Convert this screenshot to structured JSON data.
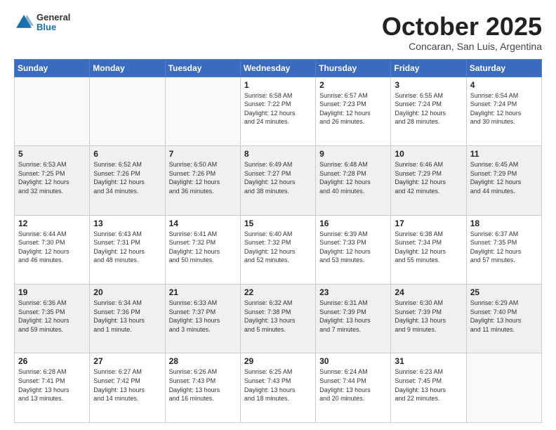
{
  "header": {
    "logo_general": "General",
    "logo_blue": "Blue",
    "month": "October 2025",
    "location": "Concaran, San Luis, Argentina"
  },
  "days_of_week": [
    "Sunday",
    "Monday",
    "Tuesday",
    "Wednesday",
    "Thursday",
    "Friday",
    "Saturday"
  ],
  "weeks": [
    [
      {
        "day": "",
        "info": ""
      },
      {
        "day": "",
        "info": ""
      },
      {
        "day": "",
        "info": ""
      },
      {
        "day": "1",
        "info": "Sunrise: 6:58 AM\nSunset: 7:22 PM\nDaylight: 12 hours\nand 24 minutes."
      },
      {
        "day": "2",
        "info": "Sunrise: 6:57 AM\nSunset: 7:23 PM\nDaylight: 12 hours\nand 26 minutes."
      },
      {
        "day": "3",
        "info": "Sunrise: 6:55 AM\nSunset: 7:24 PM\nDaylight: 12 hours\nand 28 minutes."
      },
      {
        "day": "4",
        "info": "Sunrise: 6:54 AM\nSunset: 7:24 PM\nDaylight: 12 hours\nand 30 minutes."
      }
    ],
    [
      {
        "day": "5",
        "info": "Sunrise: 6:53 AM\nSunset: 7:25 PM\nDaylight: 12 hours\nand 32 minutes."
      },
      {
        "day": "6",
        "info": "Sunrise: 6:52 AM\nSunset: 7:26 PM\nDaylight: 12 hours\nand 34 minutes."
      },
      {
        "day": "7",
        "info": "Sunrise: 6:50 AM\nSunset: 7:26 PM\nDaylight: 12 hours\nand 36 minutes."
      },
      {
        "day": "8",
        "info": "Sunrise: 6:49 AM\nSunset: 7:27 PM\nDaylight: 12 hours\nand 38 minutes."
      },
      {
        "day": "9",
        "info": "Sunrise: 6:48 AM\nSunset: 7:28 PM\nDaylight: 12 hours\nand 40 minutes."
      },
      {
        "day": "10",
        "info": "Sunrise: 6:46 AM\nSunset: 7:29 PM\nDaylight: 12 hours\nand 42 minutes."
      },
      {
        "day": "11",
        "info": "Sunrise: 6:45 AM\nSunset: 7:29 PM\nDaylight: 12 hours\nand 44 minutes."
      }
    ],
    [
      {
        "day": "12",
        "info": "Sunrise: 6:44 AM\nSunset: 7:30 PM\nDaylight: 12 hours\nand 46 minutes."
      },
      {
        "day": "13",
        "info": "Sunrise: 6:43 AM\nSunset: 7:31 PM\nDaylight: 12 hours\nand 48 minutes."
      },
      {
        "day": "14",
        "info": "Sunrise: 6:41 AM\nSunset: 7:32 PM\nDaylight: 12 hours\nand 50 minutes."
      },
      {
        "day": "15",
        "info": "Sunrise: 6:40 AM\nSunset: 7:32 PM\nDaylight: 12 hours\nand 52 minutes."
      },
      {
        "day": "16",
        "info": "Sunrise: 6:39 AM\nSunset: 7:33 PM\nDaylight: 12 hours\nand 53 minutes."
      },
      {
        "day": "17",
        "info": "Sunrise: 6:38 AM\nSunset: 7:34 PM\nDaylight: 12 hours\nand 55 minutes."
      },
      {
        "day": "18",
        "info": "Sunrise: 6:37 AM\nSunset: 7:35 PM\nDaylight: 12 hours\nand 57 minutes."
      }
    ],
    [
      {
        "day": "19",
        "info": "Sunrise: 6:36 AM\nSunset: 7:35 PM\nDaylight: 12 hours\nand 59 minutes."
      },
      {
        "day": "20",
        "info": "Sunrise: 6:34 AM\nSunset: 7:36 PM\nDaylight: 13 hours\nand 1 minute."
      },
      {
        "day": "21",
        "info": "Sunrise: 6:33 AM\nSunset: 7:37 PM\nDaylight: 13 hours\nand 3 minutes."
      },
      {
        "day": "22",
        "info": "Sunrise: 6:32 AM\nSunset: 7:38 PM\nDaylight: 13 hours\nand 5 minutes."
      },
      {
        "day": "23",
        "info": "Sunrise: 6:31 AM\nSunset: 7:39 PM\nDaylight: 13 hours\nand 7 minutes."
      },
      {
        "day": "24",
        "info": "Sunrise: 6:30 AM\nSunset: 7:39 PM\nDaylight: 13 hours\nand 9 minutes."
      },
      {
        "day": "25",
        "info": "Sunrise: 6:29 AM\nSunset: 7:40 PM\nDaylight: 13 hours\nand 11 minutes."
      }
    ],
    [
      {
        "day": "26",
        "info": "Sunrise: 6:28 AM\nSunset: 7:41 PM\nDaylight: 13 hours\nand 13 minutes."
      },
      {
        "day": "27",
        "info": "Sunrise: 6:27 AM\nSunset: 7:42 PM\nDaylight: 13 hours\nand 14 minutes."
      },
      {
        "day": "28",
        "info": "Sunrise: 6:26 AM\nSunset: 7:43 PM\nDaylight: 13 hours\nand 16 minutes."
      },
      {
        "day": "29",
        "info": "Sunrise: 6:25 AM\nSunset: 7:43 PM\nDaylight: 13 hours\nand 18 minutes."
      },
      {
        "day": "30",
        "info": "Sunrise: 6:24 AM\nSunset: 7:44 PM\nDaylight: 13 hours\nand 20 minutes."
      },
      {
        "day": "31",
        "info": "Sunrise: 6:23 AM\nSunset: 7:45 PM\nDaylight: 13 hours\nand 22 minutes."
      },
      {
        "day": "",
        "info": ""
      }
    ]
  ]
}
